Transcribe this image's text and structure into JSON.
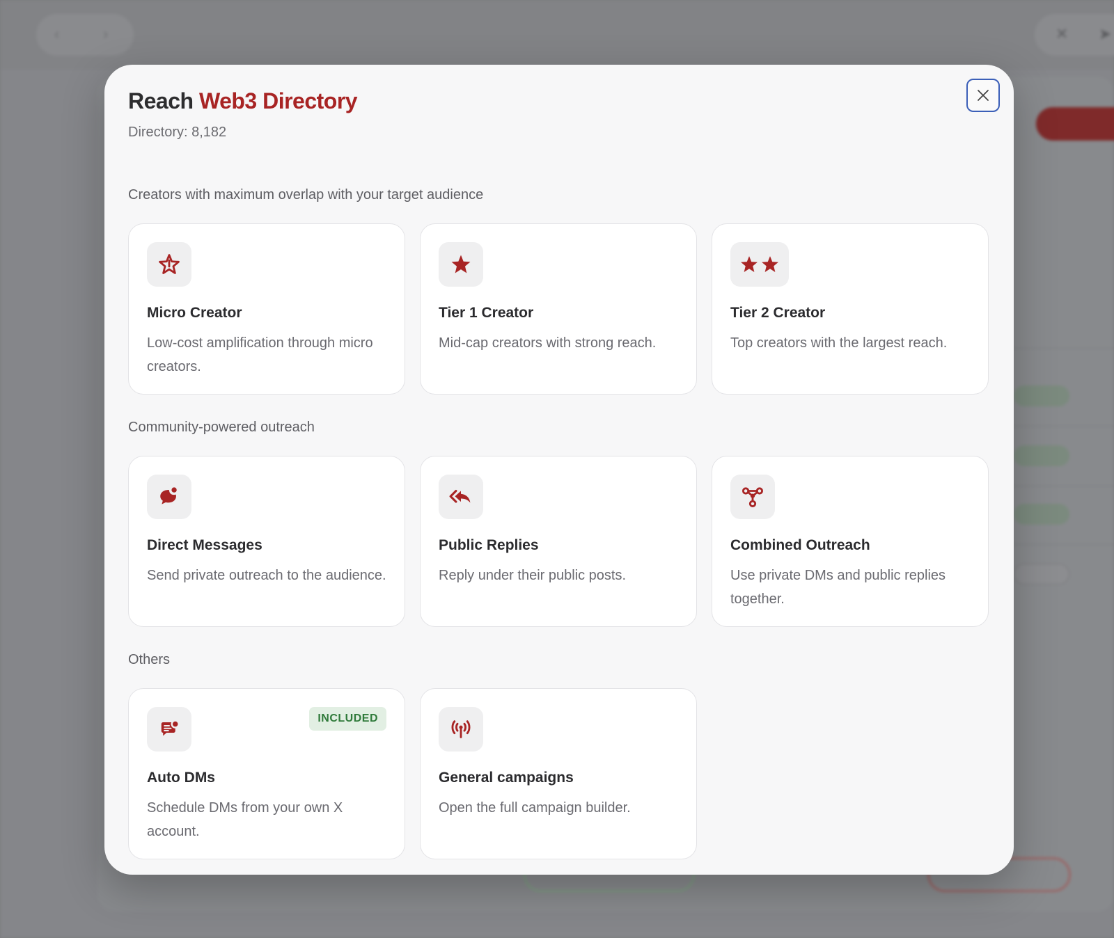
{
  "modal": {
    "title_prefix": "Reach",
    "title_accent": "Web3 Directory",
    "subtitle": "Directory: 8,182",
    "close_icon": "close-icon"
  },
  "sections": [
    {
      "label": "Creators with maximum overlap with your target audience",
      "cards": [
        {
          "icon": "star-outline-icon",
          "title": "Micro Creator",
          "description": "Low-cost amplification through micro creators."
        },
        {
          "icon": "star-icon",
          "title": "Tier 1 Creator",
          "description": "Mid-cap creators with strong reach."
        },
        {
          "icon": "two-stars-icon",
          "title": "Tier 2 Creator",
          "description": "Top creators with the largest reach."
        }
      ]
    },
    {
      "label": "Community-powered outreach",
      "cards": [
        {
          "icon": "chat-bubble-icon",
          "title": "Direct Messages",
          "description": "Send private outreach to the audience."
        },
        {
          "icon": "reply-all-icon",
          "title": "Public Replies",
          "description": "Reply under their public posts."
        },
        {
          "icon": "network-icon",
          "title": "Combined Outreach",
          "description": "Use private DMs and public replies together."
        }
      ]
    },
    {
      "label": "Others",
      "cards": [
        {
          "icon": "auto-message-icon",
          "title": "Auto DMs",
          "description": "Schedule DMs from your own X account.",
          "badge": "INCLUDED"
        },
        {
          "icon": "broadcast-icon",
          "title": "General campaigns",
          "description": "Open the full campaign builder."
        }
      ]
    }
  ],
  "colors": {
    "accent": "#a82424",
    "badge_bg": "#e2efe3",
    "badge_text": "#2f7a3a",
    "close_border": "#3b5fb8"
  }
}
